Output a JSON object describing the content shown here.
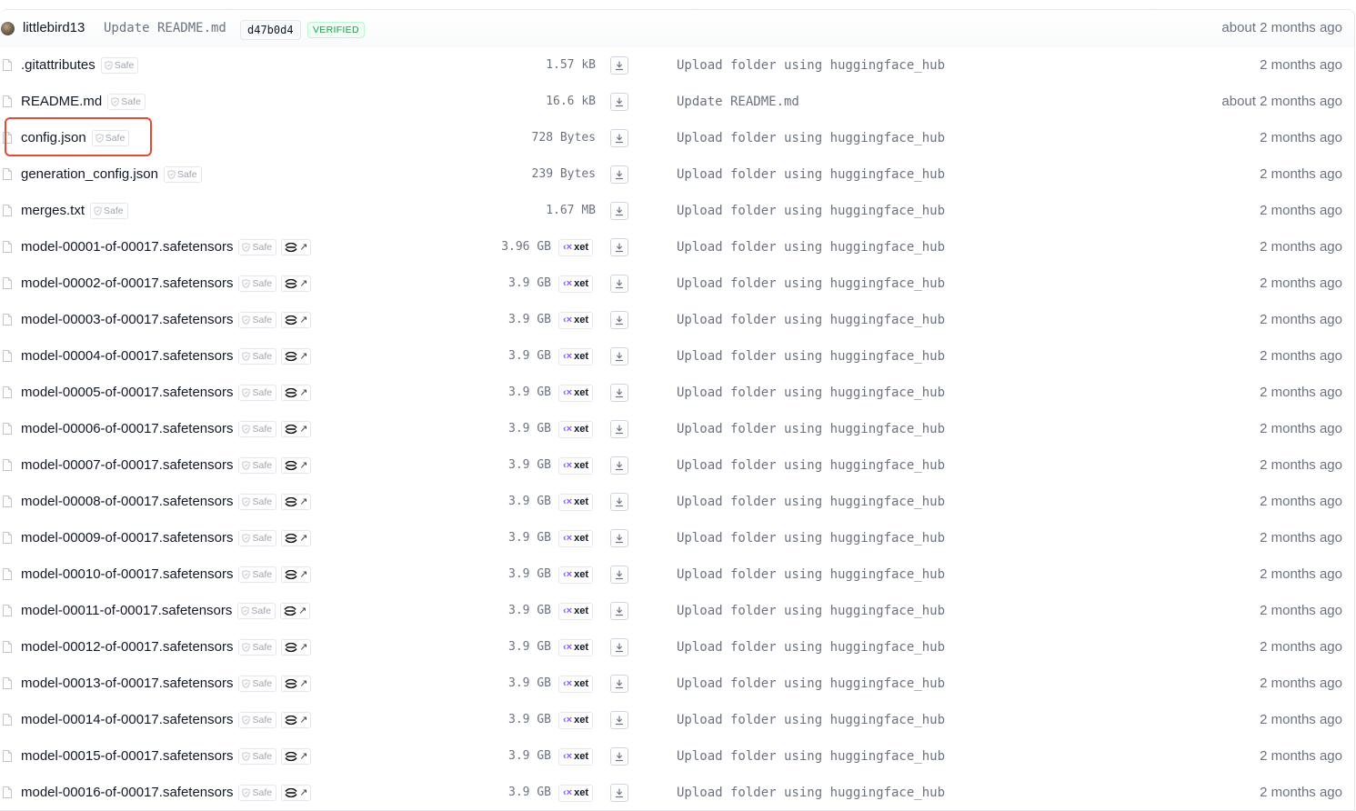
{
  "header": {
    "author": "littlebird13",
    "commit_message": "Update README.md",
    "commit_hash": "d47b0d4",
    "verified_label": "VERIFIED",
    "time": "about 2 months ago"
  },
  "labels": {
    "safe": "Safe",
    "xet": "xet"
  },
  "icons": {
    "file": "file-icon",
    "safe": "shield-check-icon",
    "viewer": "tensor-viewer-icon",
    "xet": "xet-icon",
    "download": "download-icon"
  },
  "colors": {
    "highlight": "#e24c32",
    "verified": "#16a34a",
    "xet": "#8b5cf6"
  },
  "files": [
    {
      "name": ".gitattributes",
      "size": "1.57 kB",
      "message": "Upload folder using huggingface_hub",
      "time": "2 months ago",
      "xet": false,
      "viewer": false
    },
    {
      "name": "README.md",
      "size": "16.6 kB",
      "message": "Update README.md",
      "time": "about 2 months ago",
      "xet": false,
      "viewer": false
    },
    {
      "name": "config.json",
      "size": "728 Bytes",
      "message": "Upload folder using huggingface_hub",
      "time": "2 months ago",
      "xet": false,
      "viewer": false,
      "highlighted": true
    },
    {
      "name": "generation_config.json",
      "size": "239 Bytes",
      "message": "Upload folder using huggingface_hub",
      "time": "2 months ago",
      "xet": false,
      "viewer": false
    },
    {
      "name": "merges.txt",
      "size": "1.67 MB",
      "message": "Upload folder using huggingface_hub",
      "time": "2 months ago",
      "xet": false,
      "viewer": false
    },
    {
      "name": "model-00001-of-00017.safetensors",
      "size": "3.96 GB",
      "message": "Upload folder using huggingface_hub",
      "time": "2 months ago",
      "xet": true,
      "viewer": true
    },
    {
      "name": "model-00002-of-00017.safetensors",
      "size": "3.9 GB",
      "message": "Upload folder using huggingface_hub",
      "time": "2 months ago",
      "xet": true,
      "viewer": true
    },
    {
      "name": "model-00003-of-00017.safetensors",
      "size": "3.9 GB",
      "message": "Upload folder using huggingface_hub",
      "time": "2 months ago",
      "xet": true,
      "viewer": true
    },
    {
      "name": "model-00004-of-00017.safetensors",
      "size": "3.9 GB",
      "message": "Upload folder using huggingface_hub",
      "time": "2 months ago",
      "xet": true,
      "viewer": true
    },
    {
      "name": "model-00005-of-00017.safetensors",
      "size": "3.9 GB",
      "message": "Upload folder using huggingface_hub",
      "time": "2 months ago",
      "xet": true,
      "viewer": true
    },
    {
      "name": "model-00006-of-00017.safetensors",
      "size": "3.9 GB",
      "message": "Upload folder using huggingface_hub",
      "time": "2 months ago",
      "xet": true,
      "viewer": true
    },
    {
      "name": "model-00007-of-00017.safetensors",
      "size": "3.9 GB",
      "message": "Upload folder using huggingface_hub",
      "time": "2 months ago",
      "xet": true,
      "viewer": true
    },
    {
      "name": "model-00008-of-00017.safetensors",
      "size": "3.9 GB",
      "message": "Upload folder using huggingface_hub",
      "time": "2 months ago",
      "xet": true,
      "viewer": true
    },
    {
      "name": "model-00009-of-00017.safetensors",
      "size": "3.9 GB",
      "message": "Upload folder using huggingface_hub",
      "time": "2 months ago",
      "xet": true,
      "viewer": true
    },
    {
      "name": "model-00010-of-00017.safetensors",
      "size": "3.9 GB",
      "message": "Upload folder using huggingface_hub",
      "time": "2 months ago",
      "xet": true,
      "viewer": true
    },
    {
      "name": "model-00011-of-00017.safetensors",
      "size": "3.9 GB",
      "message": "Upload folder using huggingface_hub",
      "time": "2 months ago",
      "xet": true,
      "viewer": true
    },
    {
      "name": "model-00012-of-00017.safetensors",
      "size": "3.9 GB",
      "message": "Upload folder using huggingface_hub",
      "time": "2 months ago",
      "xet": true,
      "viewer": true
    },
    {
      "name": "model-00013-of-00017.safetensors",
      "size": "3.9 GB",
      "message": "Upload folder using huggingface_hub",
      "time": "2 months ago",
      "xet": true,
      "viewer": true
    },
    {
      "name": "model-00014-of-00017.safetensors",
      "size": "3.9 GB",
      "message": "Upload folder using huggingface_hub",
      "time": "2 months ago",
      "xet": true,
      "viewer": true
    },
    {
      "name": "model-00015-of-00017.safetensors",
      "size": "3.9 GB",
      "message": "Upload folder using huggingface_hub",
      "time": "2 months ago",
      "xet": true,
      "viewer": true
    },
    {
      "name": "model-00016-of-00017.safetensors",
      "size": "3.9 GB",
      "message": "Upload folder using huggingface_hub",
      "time": "2 months ago",
      "xet": true,
      "viewer": true
    }
  ]
}
